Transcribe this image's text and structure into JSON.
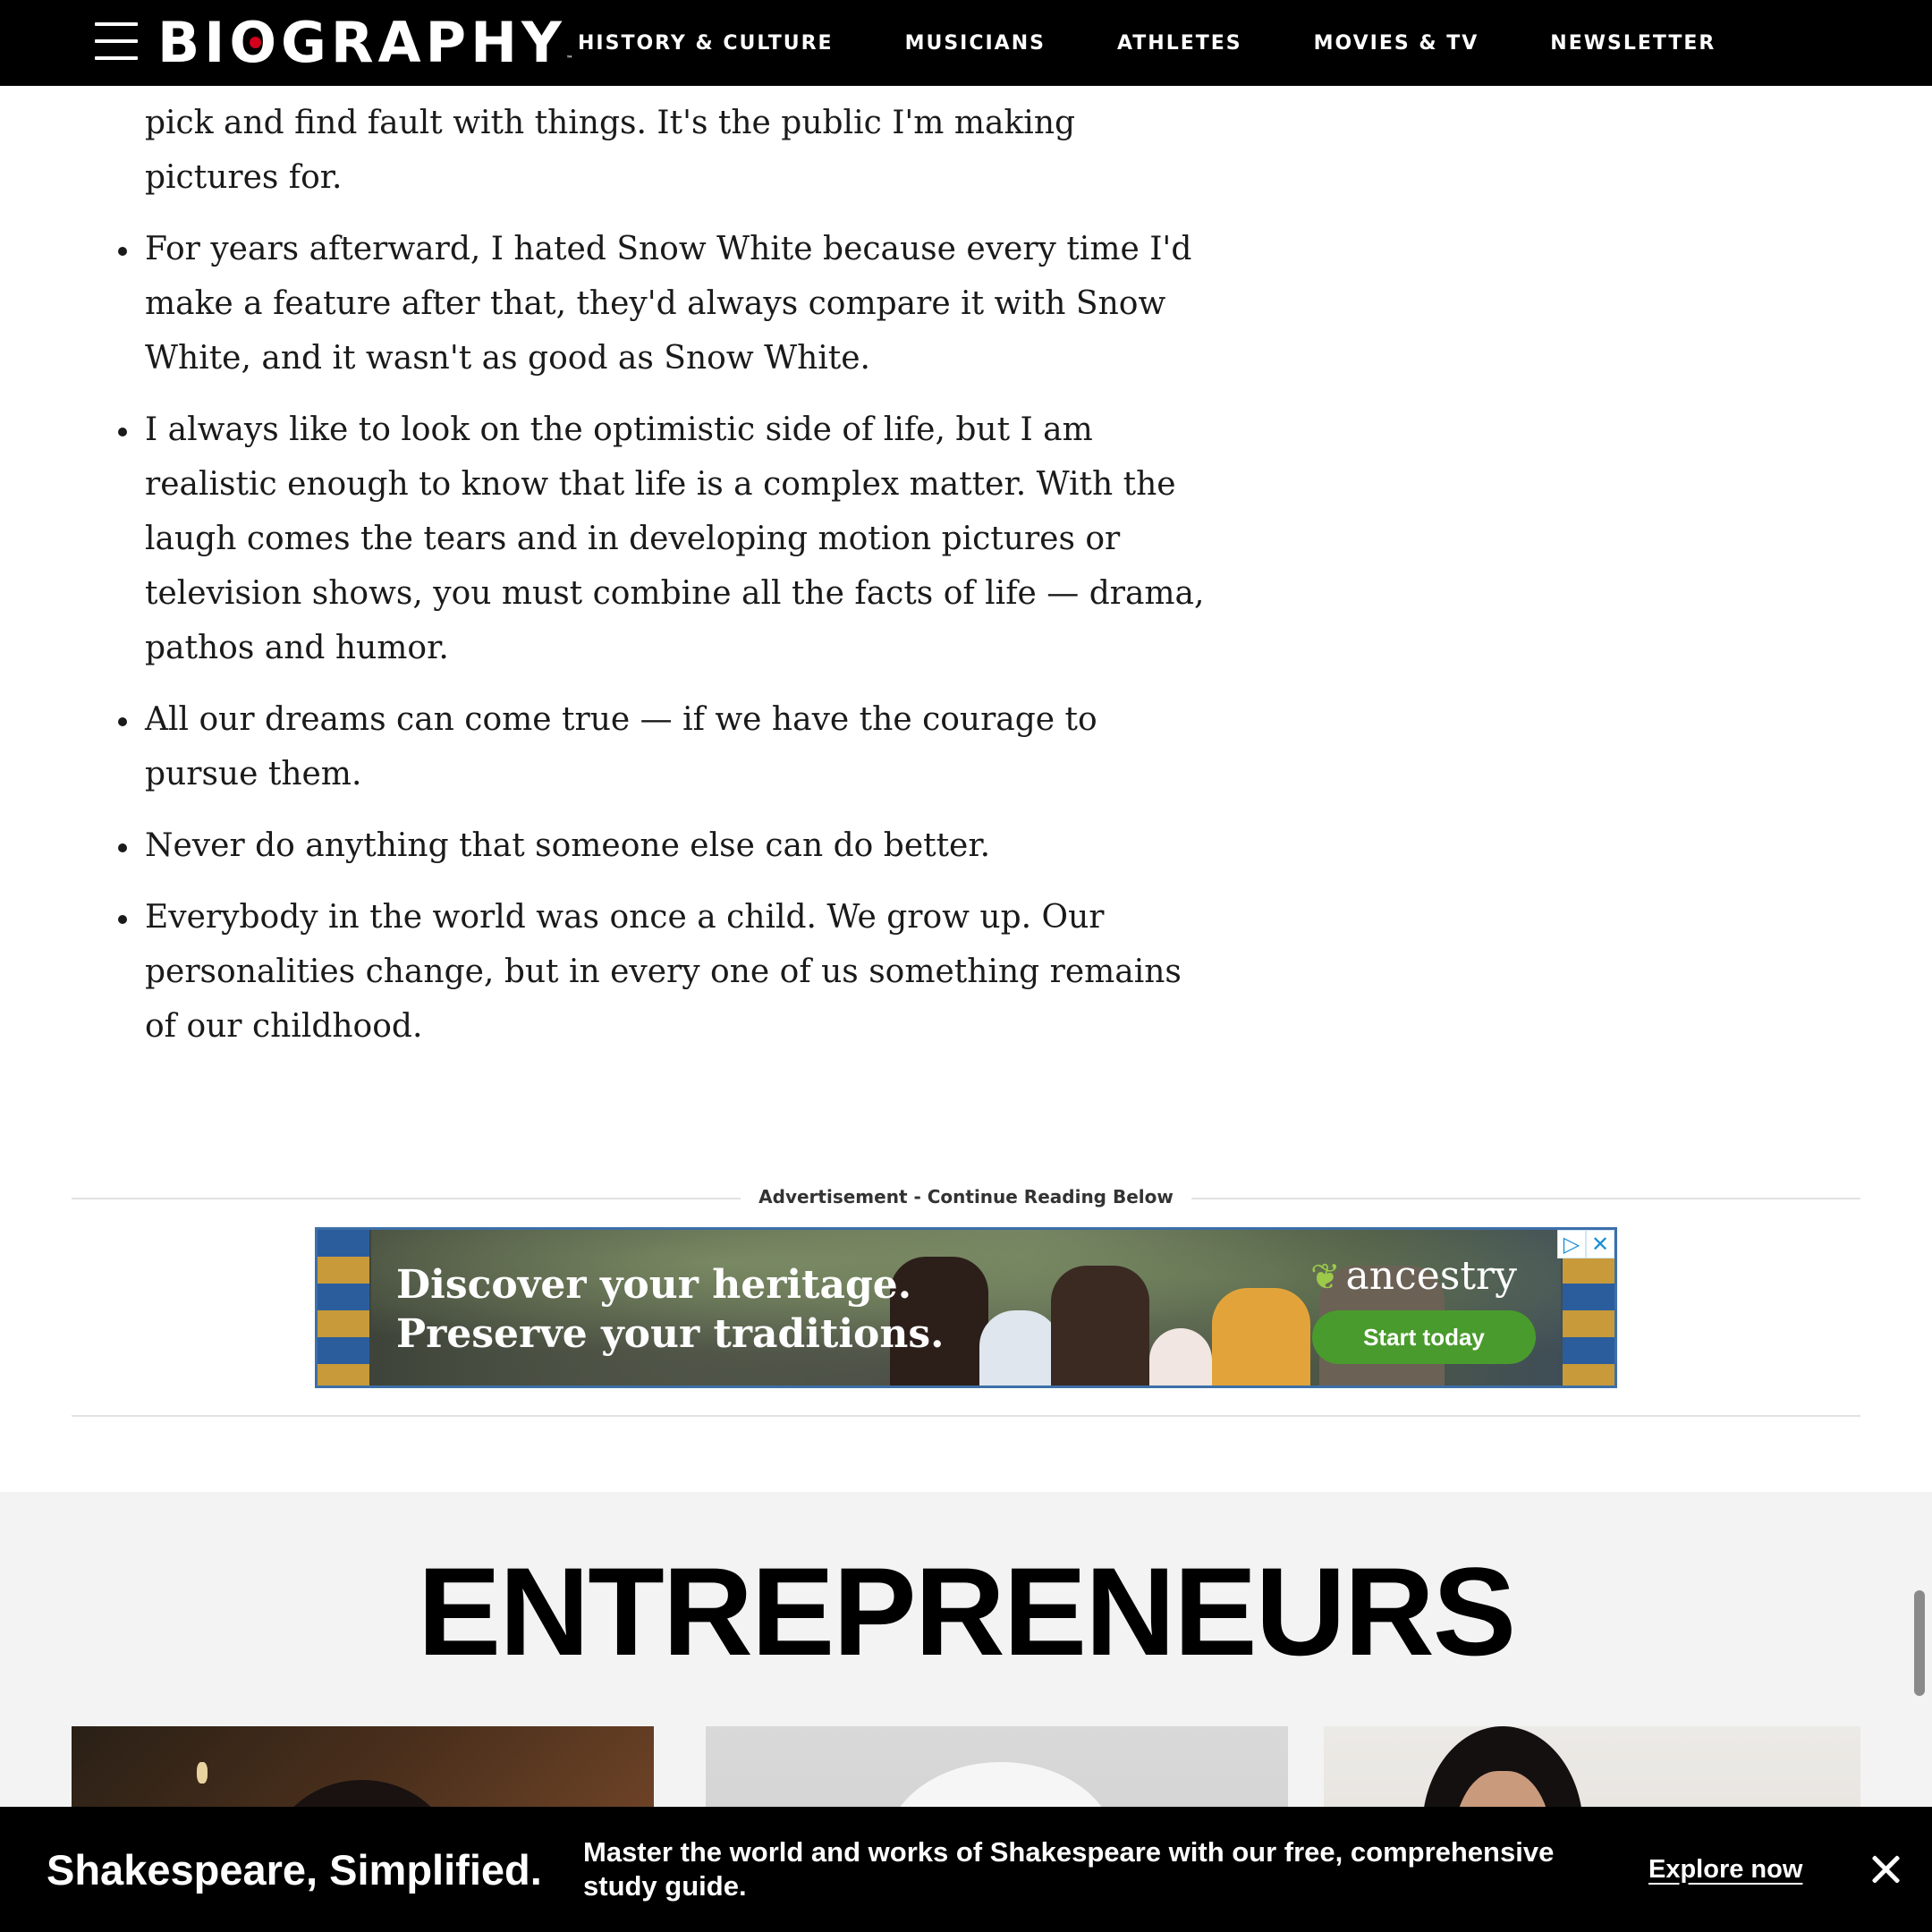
{
  "header": {
    "logo_text": "BIOGRAPHY",
    "nav": [
      {
        "label": "HISTORY & CULTURE"
      },
      {
        "label": "MUSICIANS"
      },
      {
        "label": "ATHLETES"
      },
      {
        "label": "MOVIES & TV"
      },
      {
        "label": "NEWSLETTER"
      }
    ]
  },
  "quotes": [
    {
      "text": "think the only way to be noticed and to be the smart guy is to pick and find fault with things. It's the public I'm making pictures for."
    },
    {
      "text": "For years afterward, I hated Snow White because every time I'd make a feature after that, they'd always compare it with Snow White, and it wasn't as good as Snow White."
    },
    {
      "text": "I always like to look on the optimistic side of life, but I am realistic enough to know that life is a complex matter. With the laugh comes the tears and in developing motion pictures or television shows, you must combine all the facts of life — drama, pathos and humor."
    },
    {
      "text": "All our dreams can come true — if we have the courage to pursue them."
    },
    {
      "text": "Never do anything that someone else can do better."
    },
    {
      "text": "Everybody in the world was once a child. We grow up. Our personalities change, but in every one of us something remains of our childhood."
    }
  ],
  "advertisement": {
    "label": "Advertisement - Continue Reading Below",
    "headline_1": "Discover your heritage.",
    "headline_2": "Preserve your traditions.",
    "brand": "ancestry",
    "cta": "Start today",
    "brand_color": "#4a9b2d"
  },
  "section": {
    "title": "ENTREPRENEURS"
  },
  "promo": {
    "title": "Shakespeare, Simplified.",
    "description": "Master the world and works of Shakespeare with our free, comprehensive study guide.",
    "link": "Explore now"
  },
  "icons": {
    "menu": "hamburger-icon",
    "close": "close-icon",
    "ad_choices": "adchoices-icon"
  }
}
